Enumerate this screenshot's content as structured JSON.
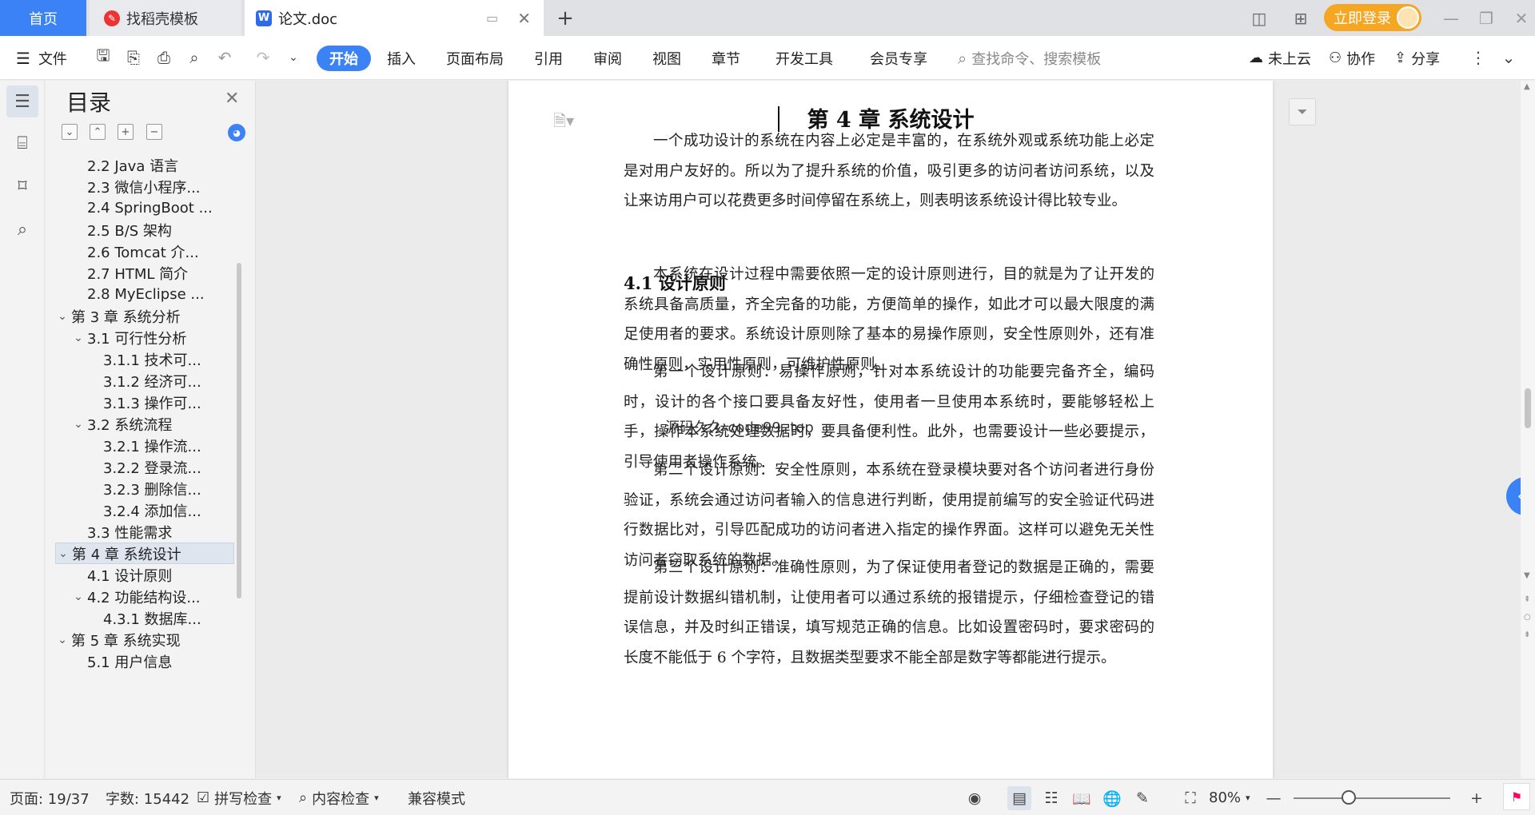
{
  "tabs": {
    "home": "首页",
    "template": "找稻壳模板",
    "doc": "论文.doc"
  },
  "titlebar": {
    "login": "立即登录"
  },
  "menubar": {
    "file": "文件",
    "tabs": [
      "开始",
      "插入",
      "页面布局",
      "引用",
      "审阅",
      "视图",
      "章节",
      "开发工具",
      "会员专享"
    ],
    "search_placeholder": "查找命令、搜索模板",
    "cloud": "未上云",
    "collab": "协作",
    "share": "分享"
  },
  "toc": {
    "title": "目录",
    "items": [
      {
        "label": "2.2 Java 语言",
        "level": 2,
        "chevron": false
      },
      {
        "label": "2.3  微信小程序...",
        "level": 2,
        "chevron": false
      },
      {
        "label": "2.4 SpringBoot ...",
        "level": 2,
        "chevron": false
      },
      {
        "label": "2.5 B/S 架构",
        "level": 2,
        "chevron": false
      },
      {
        "label": "2.6 Tomcat  介...",
        "level": 2,
        "chevron": false
      },
      {
        "label": "2.7 HTML 简介",
        "level": 2,
        "chevron": false
      },
      {
        "label": "2.8 MyEclipse ...",
        "level": 2,
        "chevron": false
      },
      {
        "label": "第 3 章  系统分析",
        "level": 1,
        "chevron": true
      },
      {
        "label": "3.1  可行性分析",
        "level": 2,
        "chevron": true
      },
      {
        "label": "3.1.1  技术可...",
        "level": 3,
        "chevron": false
      },
      {
        "label": "3.1.2  经济可...",
        "level": 3,
        "chevron": false
      },
      {
        "label": "3.1.3  操作可...",
        "level": 3,
        "chevron": false
      },
      {
        "label": "3.2  系统流程",
        "level": 2,
        "chevron": true
      },
      {
        "label": "3.2.1  操作流...",
        "level": 3,
        "chevron": false
      },
      {
        "label": "3.2.2  登录流...",
        "level": 3,
        "chevron": false
      },
      {
        "label": "3.2.3  删除信...",
        "level": 3,
        "chevron": false
      },
      {
        "label": "3.2.4  添加信...",
        "level": 3,
        "chevron": false
      },
      {
        "label": "3.3  性能需求",
        "level": 2,
        "chevron": false
      },
      {
        "label": "第 4 章  系统设计",
        "level": 1,
        "chevron": true,
        "selected": true
      },
      {
        "label": "4.1  设计原则",
        "level": 2,
        "chevron": false
      },
      {
        "label": "4.2  功能结构设...",
        "level": 2,
        "chevron": true
      },
      {
        "label": "4.3.1  数据库...",
        "level": 3,
        "chevron": false
      },
      {
        "label": "第 5 章  系统实现",
        "level": 1,
        "chevron": true
      },
      {
        "label": "5.1 用户信息",
        "level": 2,
        "chevron": false
      }
    ]
  },
  "document": {
    "heading": "第 4 章  系统设计",
    "intro": "一个成功设计的系统在内容上必定是丰富的，在系统外观或系统功能上必定是对用户友好的。所以为了提升系统的价值，吸引更多的访问者访问系统，以及让来访用户可以花费更多时间停留在系统上，则表明该系统设计得比较专业。",
    "section": "4.1  设计原则",
    "p1": "本系统在设计过程中需要依照一定的设计原则进行，目的就是为了让开发的系统具备高质量，齐全完备的功能，方便简单的操作，如此才可以最大限度的满足使用者的要求。系统设计原则除了基本的易操作原则，安全性原则外，还有准确性原则，实用性原则，可维护性原则。",
    "p2": "第一个设计原则：易操作原则，针对本系统设计的功能要完备齐全，编码时，设计的各个接口要具备友好性，使用者一旦使用本系统时，要能够轻松上手，操作本系统处理数据时，要具备便利性。此外，也需要设计一些必要提示，引导使用者操作系统。",
    "p3": "第二个设计原则：安全性原则，本系统在登录模块要对各个访问者进行身份验证，系统会通过访问者输入的信息进行判断，使用提前编写的安全验证代码进行数据比对，引导匹配成功的访问者进入指定的操作界面。这样可以避免无关性访问者窃取系统的数据。",
    "p4": "第三个设计原则：准确性原则，为了保证使用者登记的数据是正确的，需要提前设计数据纠错机制，让使用者可以通过系统的报错提示，仔细检查登记的错误信息，并及时纠正错误，填写规范正确的信息。比如设置密码时，要求密码的长度不能低于 6 个字符，且数据类型要求不能全部是数字等都能进行提示。",
    "watermark": "源码久久-code99. top"
  },
  "status": {
    "page": "页面: 19/37",
    "words": "字数: 15442",
    "spell": "拼写检查",
    "content": "内容检查",
    "compat": "兼容模式",
    "zoom": "80%",
    "zoom_level": 0.35
  },
  "colors": {
    "accent": "#3b82f6",
    "login": "#f5a623"
  }
}
